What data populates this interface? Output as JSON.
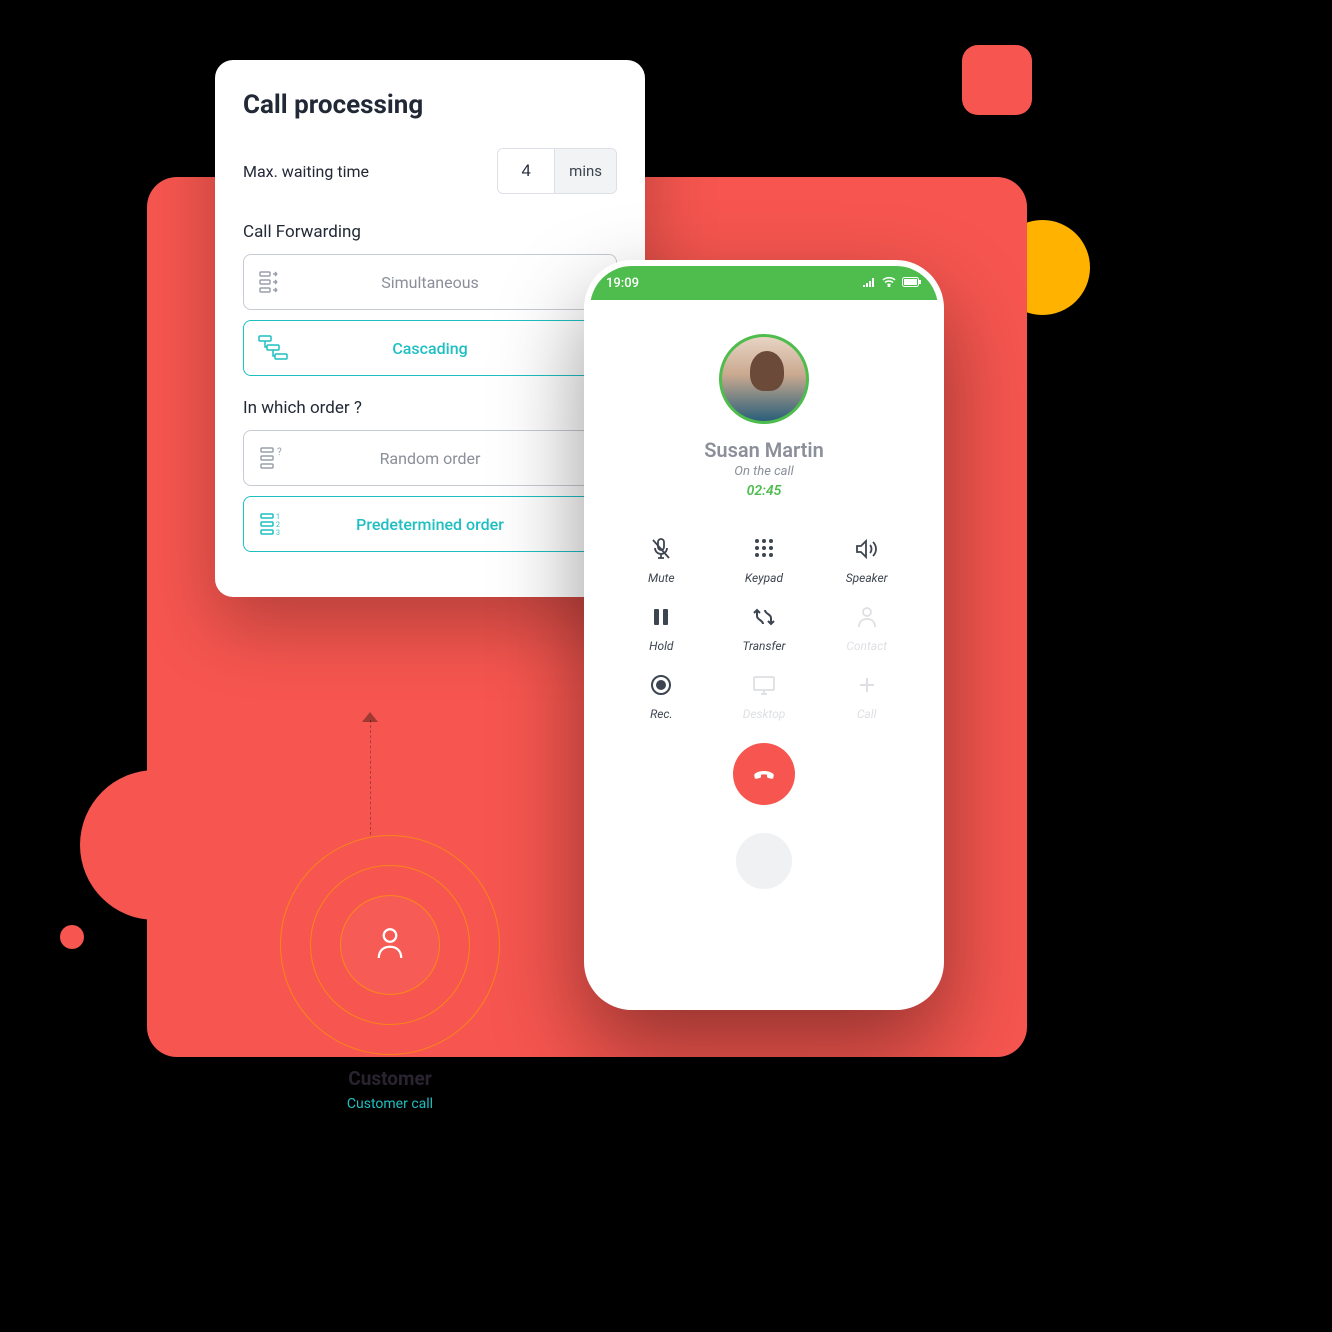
{
  "colors": {
    "accent_red": "#F6564F",
    "accent_teal": "#1FBFC2",
    "accent_green": "#4FBC4E",
    "accent_yellow": "#FFB300"
  },
  "card": {
    "title": "Call processing",
    "wait_label": "Max. waiting time",
    "wait_value": "4",
    "wait_unit": "mins",
    "forwarding": {
      "label": "Call Forwarding",
      "options": [
        {
          "label": "Simultaneous",
          "selected": false
        },
        {
          "label": "Cascading",
          "selected": true
        }
      ]
    },
    "order": {
      "label": "In which order ?",
      "options": [
        {
          "label": "Random order",
          "selected": false
        },
        {
          "label": "Predetermined order",
          "selected": true
        }
      ]
    }
  },
  "customer": {
    "title": "Customer",
    "subtitle": "Customer call"
  },
  "phone": {
    "time": "19:09",
    "caller_name": "Susan Martin",
    "caller_status": "On the call",
    "timer": "02:45",
    "actions": [
      {
        "label": "Mute",
        "icon": "mute",
        "enabled": true
      },
      {
        "label": "Keypad",
        "icon": "keypad",
        "enabled": true
      },
      {
        "label": "Speaker",
        "icon": "speaker",
        "enabled": true
      },
      {
        "label": "Hold",
        "icon": "hold",
        "enabled": true
      },
      {
        "label": "Transfer",
        "icon": "transfer",
        "enabled": true
      },
      {
        "label": "Contact",
        "icon": "contact",
        "enabled": false
      },
      {
        "label": "Rec.",
        "icon": "record",
        "enabled": true
      },
      {
        "label": "Desktop",
        "icon": "desktop",
        "enabled": false
      },
      {
        "label": "Call",
        "icon": "plus",
        "enabled": false
      }
    ]
  }
}
